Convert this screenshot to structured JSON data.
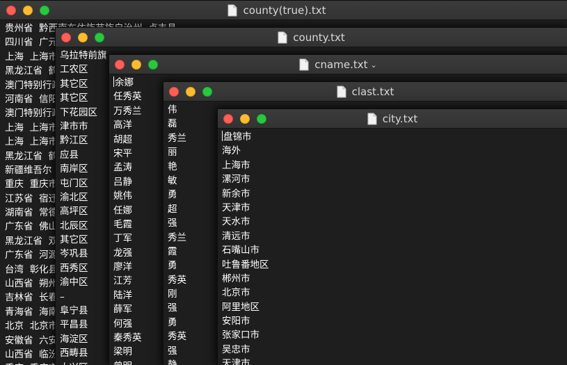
{
  "windows": [
    {
      "title": "county(true).txt",
      "lines": [
        "贵州省  黔西南布依族苗族自治州  贞丰县",
        "四川省  广元市",
        "上海  上海市",
        "黑龙江省  鹤",
        "澳门特别行政",
        "河南省  信阳",
        "澳门特别行政",
        "上海  上海市",
        "上海  上海市",
        "黑龙江省  鹤",
        "新疆维吾尔",
        "重庆  重庆市",
        "江苏省  宿迁",
        "湖南省  常德",
        "广东省  佛山",
        "黑龙江省  双",
        "广东省  河源",
        "台湾  彰化县",
        "山西省  朔州",
        "吉林省  长春",
        "青海省  海南",
        "北京  北京市",
        "安徽省  六安",
        "山西省  临汾",
        "重庆  重庆市"
      ]
    },
    {
      "title": "county.txt",
      "lines": [
        "乌拉特前旗",
        "工农区",
        "其它区",
        "其它区",
        "下花园区",
        "津市市",
        "黔江区",
        "应县",
        "南岸区",
        "屯门区",
        "渝北区",
        "高坪区",
        "北辰区",
        "其它区",
        "岑巩县",
        "西秀区",
        "渝中区",
        "–",
        "阜宁县",
        "平昌县",
        "海淀区",
        "西畴县",
        "大兴区"
      ]
    },
    {
      "title": "cname.txt",
      "chevron": "⌄",
      "lines": [
        "余娜",
        "任秀英",
        "万秀兰",
        "高洋",
        "胡超",
        "宋平",
        "孟涛",
        "吕静",
        "姚伟",
        "任娜",
        "毛霞",
        "丁军",
        "龙强",
        "廖洋",
        "江芳",
        "陆洋",
        "薛军",
        "何强",
        "秦秀英",
        "梁明",
        "曾明"
      ]
    },
    {
      "title": "clast.txt",
      "lines": [
        "伟",
        "磊",
        "秀兰",
        "丽",
        "艳",
        "敏",
        "勇",
        "超",
        "强",
        "秀兰",
        "霞",
        "勇",
        "秀英",
        "刚",
        "强",
        "勇",
        "秀英",
        "强",
        "静"
      ]
    },
    {
      "title": "city.txt",
      "lines": [
        "盘锦市",
        "海外",
        "上海市",
        "漯河市",
        "新余市",
        "天津市",
        "天水市",
        "清远市",
        "石嘴山市",
        "吐鲁番地区",
        "郴州市",
        "北京市",
        "阿里地区",
        "安阳市",
        "张家口市",
        "吴忠市",
        "天津市"
      ]
    }
  ]
}
